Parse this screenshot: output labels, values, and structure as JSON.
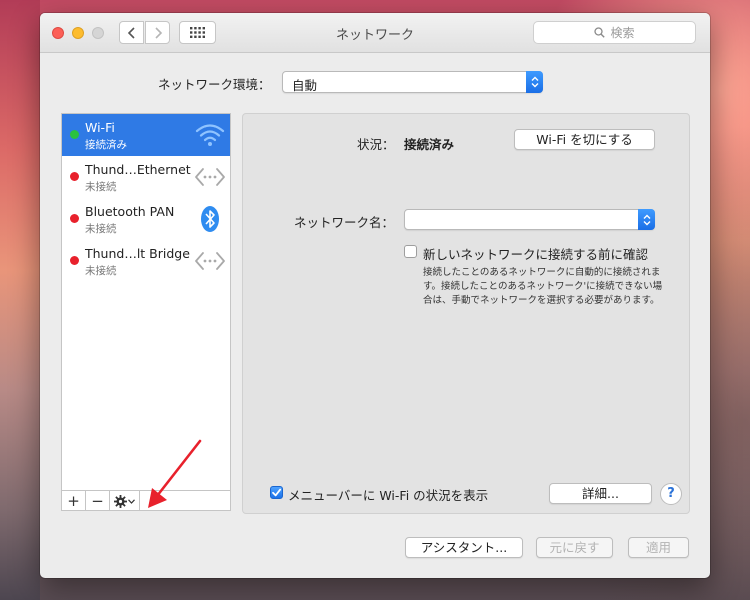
{
  "window": {
    "title": "ネットワーク",
    "search_placeholder": "検索"
  },
  "location": {
    "label": "ネットワーク環境：",
    "value": "自動"
  },
  "services": [
    {
      "name": "Wi-Fi",
      "status": "接続済み",
      "dot_color": "#2ac240",
      "icon": "wifi-icon",
      "selected": true
    },
    {
      "name": "Thund…Ethernet",
      "status": "未接続",
      "dot_color": "#e8212c",
      "icon": "ethernet-arrows-icon",
      "selected": false
    },
    {
      "name": "Bluetooth PAN",
      "status": "未接続",
      "dot_color": "#e8212c",
      "icon": "bluetooth-icon",
      "selected": false
    },
    {
      "name": "Thund…lt Bridge",
      "status": "未接続",
      "dot_color": "#e8212c",
      "icon": "bridge-arrows-icon",
      "selected": false
    }
  ],
  "sidebar_actions": {
    "add": "+",
    "remove": "−"
  },
  "detail": {
    "status_label": "状況：",
    "status_value": "接続済み",
    "wifi_toggle_button": "Wi-Fi を切にする",
    "network_name_label": "ネットワーク名：",
    "network_name_value": "",
    "confirm_checkbox_label": "新しいネットワークに接続する前に確認",
    "confirm_checked": false,
    "confirm_description": "接続したことのあるネットワークに自動的に接続されます。接続したことのあるネットワーク'に接続できない場合は、手動でネットワークを選択する必要があります。",
    "menubar_checkbox_label": "メニューバーに Wi-Fi の状況を表示",
    "menubar_checked": true,
    "advanced_button": "詳細...",
    "help_button": "?"
  },
  "footer": {
    "assistant_button": "アシスタント...",
    "revert_button": "元に戻す",
    "apply_button": "適用"
  },
  "colors": {
    "selection_blue": "#2f7ae5",
    "connected_green": "#2ac240",
    "disconnected_red": "#e8212c",
    "annotation_arrow": "#e8212c"
  }
}
